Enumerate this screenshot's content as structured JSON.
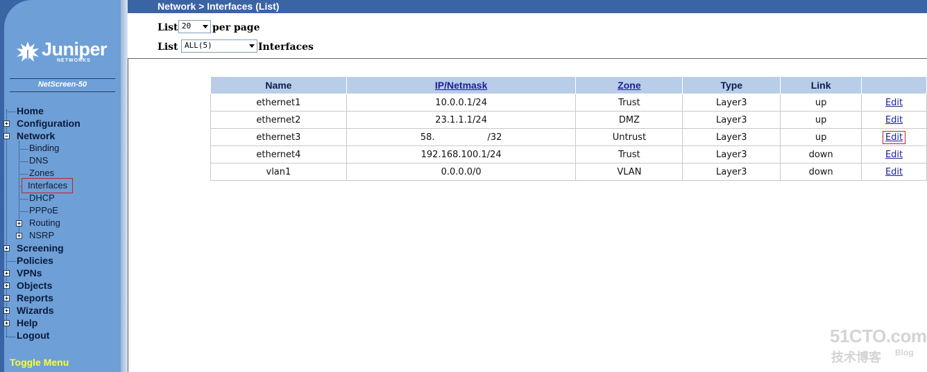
{
  "header": {
    "title": "Network > Interfaces (List)"
  },
  "sidebar": {
    "brand": "Juniper",
    "brand_sub": "NETWORKS",
    "device": "NetScreen-50",
    "items": [
      {
        "label": "Home"
      },
      {
        "label": "Configuration"
      },
      {
        "label": "Network"
      },
      {
        "label": "Binding"
      },
      {
        "label": "DNS"
      },
      {
        "label": "Zones"
      },
      {
        "label": "Interfaces"
      },
      {
        "label": "DHCP"
      },
      {
        "label": "PPPoE"
      },
      {
        "label": "Routing"
      },
      {
        "label": "NSRP"
      },
      {
        "label": "Screening"
      },
      {
        "label": "Policies"
      },
      {
        "label": "VPNs"
      },
      {
        "label": "Objects"
      },
      {
        "label": "Reports"
      },
      {
        "label": "Wizards"
      },
      {
        "label": "Help"
      },
      {
        "label": "Logout"
      }
    ],
    "selected": "Interfaces",
    "toggle_menu": "Toggle Menu"
  },
  "controls": {
    "list_label_1": "List",
    "per_page_value": "20",
    "per_page_suffix": "per page",
    "list_label_2": "List",
    "filter_value": "ALL(5)",
    "filter_suffix": "Interfaces"
  },
  "table": {
    "headers": [
      "Name",
      "IP/Netmask",
      "Zone",
      "Type",
      "Link",
      ""
    ],
    "rows": [
      {
        "name": "ethernet1",
        "ip": "10.0.0.1/24",
        "zone": "Trust",
        "type": "Layer3",
        "link": "up",
        "action": "Edit"
      },
      {
        "name": "ethernet2",
        "ip": "23.1.1.1/24",
        "zone": "DMZ",
        "type": "Layer3",
        "link": "up",
        "action": "Edit"
      },
      {
        "name": "ethernet3",
        "ip_left": "58.",
        "ip_right": "/32",
        "zone": "Untrust",
        "type": "Layer3",
        "link": "up",
        "action": "Edit"
      },
      {
        "name": "ethernet4",
        "ip": "192.168.100.1/24",
        "zone": "Trust",
        "type": "Layer3",
        "link": "down",
        "action": "Edit"
      },
      {
        "name": "vlan1",
        "ip": "0.0.0.0/0",
        "zone": "VLAN",
        "type": "Layer3",
        "link": "down",
        "action": "Edit"
      }
    ]
  },
  "watermark": {
    "main": "51CTO.com",
    "sub": "技术博客",
    "blog": "Blog"
  },
  "colors": {
    "sidebar_dark": "#3a64a4",
    "sidebar_panel": "#6e9fd6",
    "table_header": "#b8cde8",
    "link": "#1d1d9b",
    "highlight": "#c0212e",
    "toggle": "#ffff33"
  }
}
